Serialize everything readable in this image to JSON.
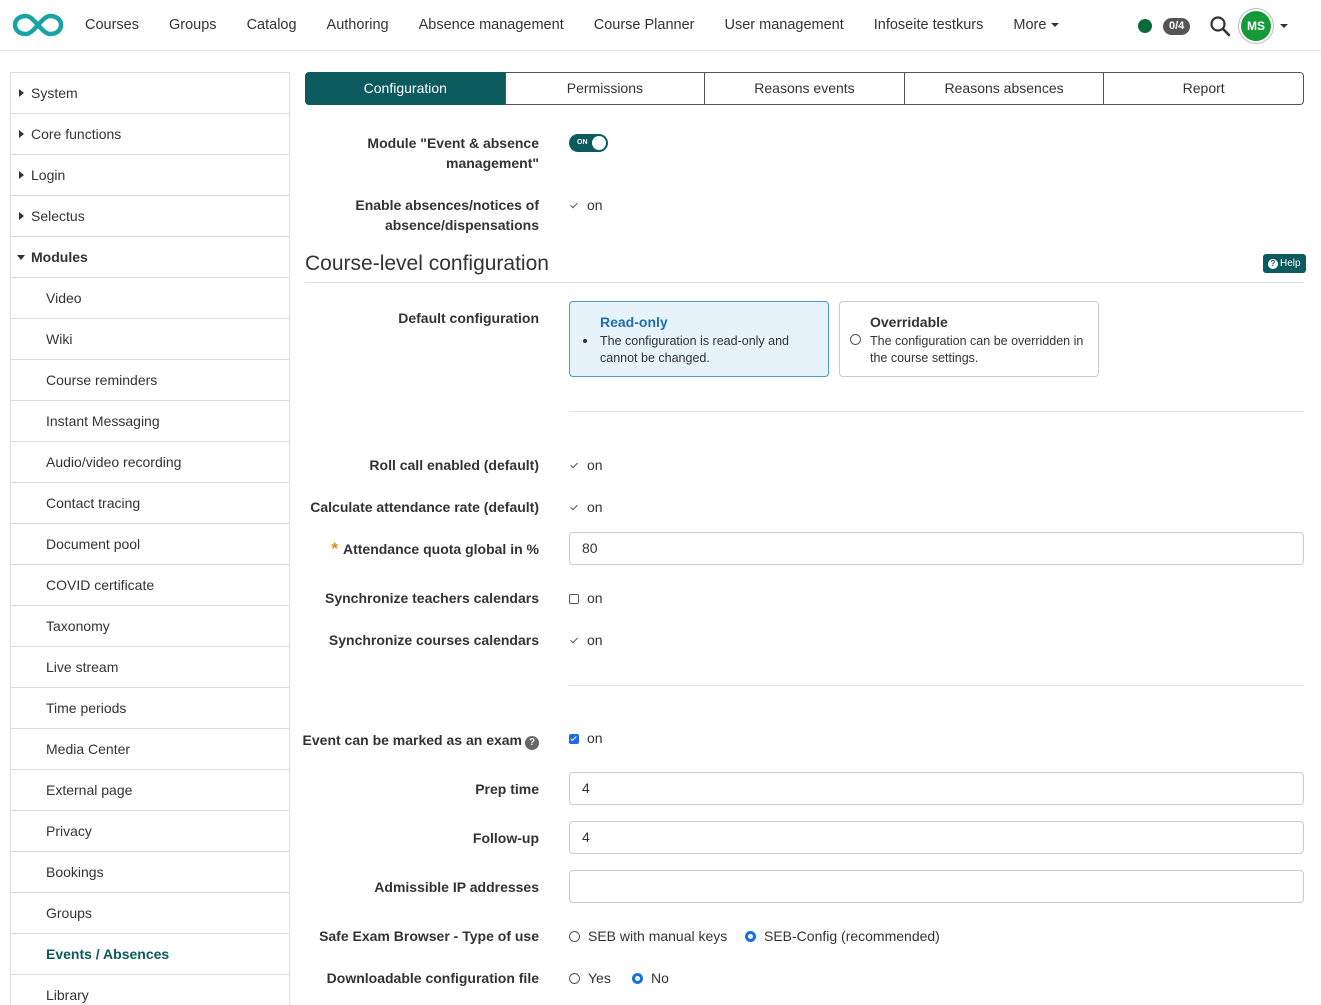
{
  "nav": {
    "links": [
      "Courses",
      "Groups",
      "Catalog",
      "Authoring",
      "Absence management",
      "Course Planner",
      "User management",
      "Infoseite testkurs"
    ],
    "more_label": "More",
    "badge": "0/4",
    "avatar_initials": "MS"
  },
  "sidebar": {
    "items": [
      {
        "label": "System"
      },
      {
        "label": "Core functions"
      },
      {
        "label": "Login"
      },
      {
        "label": "Selectus"
      },
      {
        "label": "Modules"
      },
      {
        "label": "Video"
      },
      {
        "label": "Wiki"
      },
      {
        "label": "Course reminders"
      },
      {
        "label": "Instant Messaging"
      },
      {
        "label": "Audio/video recording"
      },
      {
        "label": "Contact tracing"
      },
      {
        "label": "Document pool"
      },
      {
        "label": "COVID certificate"
      },
      {
        "label": "Taxonomy"
      },
      {
        "label": "Live stream"
      },
      {
        "label": "Time periods"
      },
      {
        "label": "Media Center"
      },
      {
        "label": "External page"
      },
      {
        "label": "Privacy"
      },
      {
        "label": "Bookings"
      },
      {
        "label": "Groups"
      },
      {
        "label": "Events / Absences"
      },
      {
        "label": "Library"
      }
    ]
  },
  "tabs": [
    "Configuration",
    "Permissions",
    "Reasons events",
    "Reasons absences",
    "Report"
  ],
  "form": {
    "module_label": "Module \"Event & absence management\"",
    "toggle_text": "ON",
    "enable_absences_label": "Enable absences/notices of absence/dispensations",
    "on_text": "on",
    "section_title": "Course-level configuration",
    "help_label": "Help",
    "default_config_label": "Default configuration",
    "readonly_title": "Read-only",
    "readonly_desc": "The configuration is read-only and cannot be changed.",
    "overridable_title": "Overridable",
    "overridable_desc": "The configuration can be overridden in the course settings.",
    "rollcall_label": "Roll call enabled (default)",
    "attendance_rate_label": "Calculate attendance rate (default)",
    "quota_label": "Attendance quota global in %",
    "quota_value": "80",
    "sync_teachers_label": "Synchronize teachers calendars",
    "sync_courses_label": "Synchronize courses calendars",
    "exam_label": "Event can be marked as an exam",
    "prep_label": "Prep time",
    "prep_value": "4",
    "followup_label": "Follow-up",
    "followup_value": "4",
    "ip_label": "Admissible IP addresses",
    "ip_value": "",
    "seb_label": "Safe Exam Browser - Type of use",
    "seb_opt1": "SEB with manual keys",
    "seb_opt2": "SEB-Config (recommended)",
    "download_label": "Downloadable configuration file",
    "download_yes": "Yes",
    "download_no": "No"
  },
  "colors": {
    "brand": "#0b5a5d",
    "radio_checked": "#1a6fe0",
    "status_online": "#0b6b3a",
    "required_star": "#e08a1a"
  }
}
